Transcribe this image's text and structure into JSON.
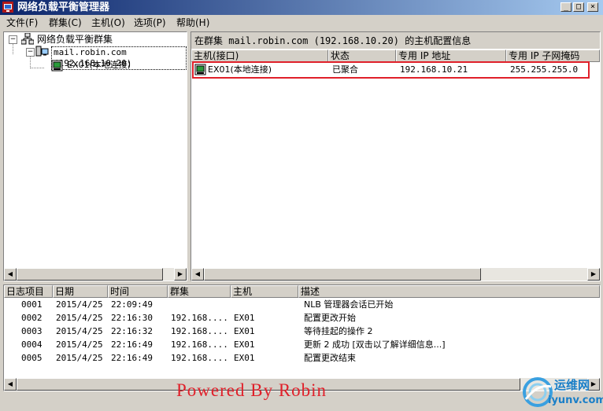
{
  "window": {
    "title": "网络负载平衡管理器"
  },
  "menu": [
    "文件(F)",
    "群集(C)",
    "主机(O)",
    "选项(P)",
    "帮助(H)"
  ],
  "tree": {
    "root": "网络负载平衡群集",
    "cluster": "mail.robin.com (192.168.10.20)",
    "host": "EX01(本地连接)"
  },
  "detail": {
    "header": "在群集 mail.robin.com (192.168.10.20) 的主机配置信息",
    "columns": [
      "主机(接口)",
      "状态",
      "专用 IP 地址",
      "专用 IP 子网掩码"
    ],
    "rows": [
      {
        "host": "EX01(本地连接)",
        "status": "已聚合",
        "ip": "192.168.10.21",
        "mask": "255.255.255.0"
      }
    ]
  },
  "log": {
    "columns": [
      "日志项目",
      "日期",
      "时间",
      "群集",
      "主机",
      "描述"
    ],
    "rows": [
      {
        "id": "0001",
        "date": "2015/4/25",
        "time": "22:09:49",
        "cluster": "",
        "host": "",
        "desc": "NLB 管理器会话已开始"
      },
      {
        "id": "0002",
        "date": "2015/4/25",
        "time": "22:16:30",
        "cluster": "192.168....",
        "host": "EX01",
        "desc": "配置更改开始"
      },
      {
        "id": "0003",
        "date": "2015/4/25",
        "time": "22:16:32",
        "cluster": "192.168....",
        "host": "EX01",
        "desc": "等待挂起的操作 2"
      },
      {
        "id": "0004",
        "date": "2015/4/25",
        "time": "22:16:49",
        "cluster": "192.168....",
        "host": "EX01",
        "desc": "更新 2 成功 [双击以了解详细信息...]"
      },
      {
        "id": "0005",
        "date": "2015/4/25",
        "time": "22:16:49",
        "cluster": "192.168....",
        "host": "EX01",
        "desc": "配置更改结束"
      }
    ]
  },
  "watermark": "Powered By Robin",
  "logo": {
    "brand": "运维网",
    "domain": "iyunv.com"
  },
  "colors": {
    "titlebar": "#0a246a",
    "highlight_border": "#e0202a",
    "watermark": "#e0202a",
    "face": "#d4d0c8"
  }
}
